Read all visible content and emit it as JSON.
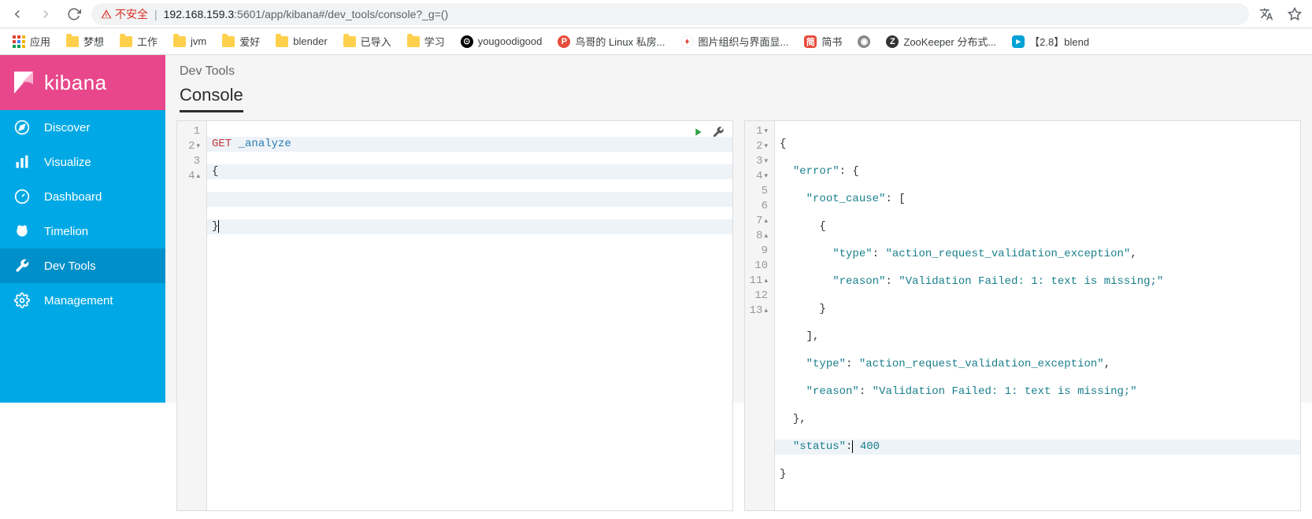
{
  "browser": {
    "insecure_label": "不安全",
    "url_host": "192.168.159.3",
    "url_port": ":5601",
    "url_path": "/app/kibana#/dev_tools/console?_g=()"
  },
  "bookmarks": {
    "apps": "应用",
    "items": [
      "梦想",
      "工作",
      "jvm",
      "爱好",
      "blender",
      "已导入",
      "学习",
      "yougoodigood",
      "鸟哥的 Linux 私房...",
      "图片组织与界面显...",
      "简书",
      "ZooKeeper 分布式...",
      "【2.8】blend"
    ]
  },
  "sidebar": {
    "brand": "kibana",
    "items": [
      {
        "label": "Discover"
      },
      {
        "label": "Visualize"
      },
      {
        "label": "Dashboard"
      },
      {
        "label": "Timelion"
      },
      {
        "label": "Dev Tools"
      },
      {
        "label": "Management"
      }
    ]
  },
  "header": {
    "breadcrumb": "Dev Tools",
    "tab": "Console"
  },
  "editor": {
    "request": {
      "method": "GET",
      "endpoint": "_analyze",
      "body_open": "{",
      "body_close": "}"
    },
    "response": {
      "l1": "{",
      "l2_key": "\"error\"",
      "l2_rest": ": {",
      "l3_key": "\"root_cause\"",
      "l3_rest": ": [",
      "l4": "{",
      "l5_key": "\"type\"",
      "l5_val": "\"action_request_validation_exception\"",
      "l6_key": "\"reason\"",
      "l6_val": "\"Validation Failed: 1: text is missing;\"",
      "l7": "}",
      "l8": "],",
      "l9_key": "\"type\"",
      "l9_val": "\"action_request_validation_exception\"",
      "l10_key": "\"reason\"",
      "l10_val": "\"Validation Failed: 1: text is missing;\"",
      "l11": "},",
      "l12_key": "\"status\"",
      "l12_val": "400",
      "l13": "}"
    }
  }
}
